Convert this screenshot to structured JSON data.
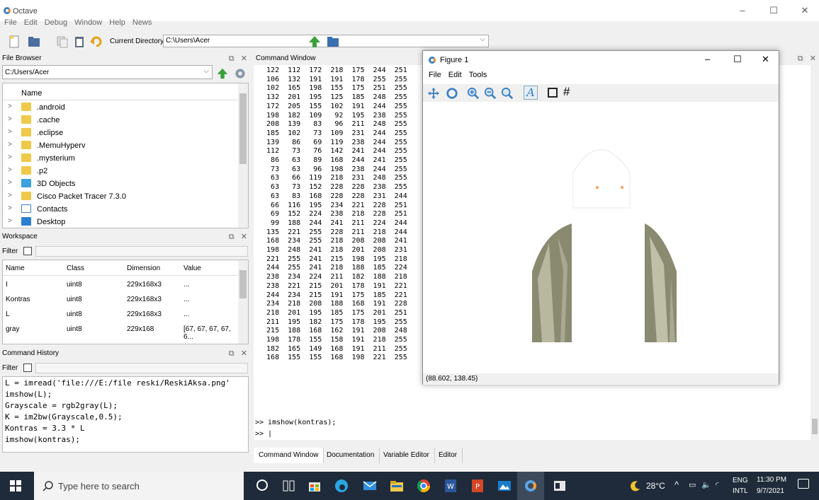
{
  "window": {
    "title": "Octave",
    "minimize": "–",
    "maximize": "☐",
    "close": "✕"
  },
  "menu": [
    "File",
    "Edit",
    "Debug",
    "Window",
    "Help",
    "News"
  ],
  "toolbar": {
    "current_dir_label": "Current Directory:",
    "current_dir_value": "C:\\Users\\Acer"
  },
  "file_browser": {
    "title": "File Browser",
    "path": "C:/Users/Acer",
    "column": "Name",
    "items": [
      ".android",
      ".cache",
      ".eclipse",
      ".MemuHyperv",
      ".mysterium",
      ".p2",
      "3D Objects",
      "Cisco Packet Tracer 7.3.0",
      "Contacts",
      "Desktop"
    ]
  },
  "workspace": {
    "title": "Workspace",
    "filter_label": "Filter",
    "headers": [
      "Name",
      "Class",
      "Dimension",
      "Value"
    ],
    "rows": [
      [
        "I",
        "uint8",
        "229x168x3",
        "..."
      ],
      [
        "Kontras",
        "uint8",
        "229x168x3",
        "..."
      ],
      [
        "L",
        "uint8",
        "229x168x3",
        "..."
      ],
      [
        "gray",
        "uint8",
        "229x168",
        "[67, 67, 67, 67, 6..."
      ]
    ]
  },
  "command_history": {
    "title": "Command History",
    "filter_label": "Filter",
    "lines": [
      "L = imread('file:///E:/file reski/ReskiAksa.png'",
      "imshow(L);",
      "Grayscale = rgb2gray(L);",
      "K = im2bw(Grayscale,0.5);",
      "Kontras = 3.3 * L",
      "imshow(kontras);"
    ]
  },
  "command_window": {
    "title": "Command Window",
    "matrix_rows": [
      "  122  112  172  218  175  244  251",
      "  106  132  191  191  178  255  255",
      "  102  165  198  155  175  251  255",
      "  132  201  195  125  185  248  255",
      "  172  205  155  102  191  244  255",
      "  198  182  109   92  195  238  255",
      "  208  139   83   96  211  248  255",
      "  185  102   73  109  231  244  255",
      "  139   86   69  119  238  244  255",
      "  112   73   76  142  241  244  255",
      "   86   63   89  168  244  241  255",
      "   73   63   96  198  238  244  255",
      "   63   66  119  218  231  248  255",
      "   63   73  152  228  228  238  255",
      "   63   83  168  228  228  231  244",
      "   66  116  195  234  221  228  251",
      "   69  152  224  238  218  228  251",
      "   99  188  244  241  211  224  244",
      "  135  221  255  228  211  218  244",
      "  168  234  255  218  208  208  241",
      "  198  248  241  218  201  208  231",
      "  221  255  241  215  198  195  218",
      "  244  255  241  218  188  185  224",
      "  238  234  224  211  182  188  218",
      "  238  221  215  201  178  191  221",
      "  244  234  215  191  175  185  221",
      "  234  218  208  188  168  191  228",
      "  218  201  195  185  175  201  251",
      "  211  195  182  175  178  195  255",
      "  215  188  168  162  191  208  248",
      "  198  178  155  158  191  218  255",
      "  182  165  149  168  191  211  255",
      "  168  155  155  168  198  221  255"
    ],
    "last_command": ">> imshow(kontras);",
    "prompt": ">> |",
    "tabs": [
      "Command Window",
      "Documentation",
      "Variable Editor",
      "Editor"
    ]
  },
  "figure": {
    "title": "Figure 1",
    "menu": [
      "File",
      "Edit",
      "Tools"
    ],
    "status": "(88.602, 138.45)",
    "tools": [
      "pan-icon",
      "rotate-icon",
      "zoom-in-icon",
      "zoom-out-icon",
      "zoom-reset-icon",
      "text-icon",
      "box-icon",
      "grid-icon"
    ]
  },
  "taskbar": {
    "search_placeholder": "Type here to search",
    "weather": "28°C",
    "lang_top": "ENG",
    "lang_bottom": "INTL",
    "time": "11:30 PM",
    "date": "9/7/2021"
  },
  "colors": {
    "taskbar": "#1f2b3a",
    "folder": "#f0c94a",
    "octave_blue": "#3a7fc4"
  }
}
